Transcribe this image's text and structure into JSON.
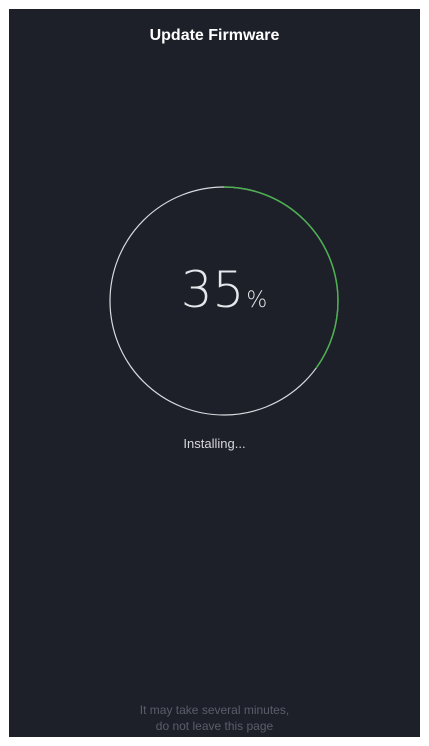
{
  "header": {
    "title": "Update Firmware"
  },
  "progress": {
    "value": 35,
    "number_text": "35",
    "unit_text": "%",
    "track_color": "#d9dadf",
    "fill_color": "#4caf50"
  },
  "status": {
    "text": "Installing..."
  },
  "notice": {
    "line1": "It may take several minutes,",
    "line2": "do not leave this page"
  }
}
